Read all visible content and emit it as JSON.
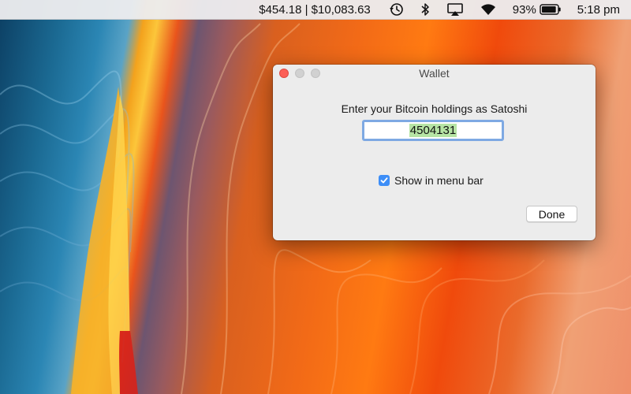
{
  "menubar": {
    "price_display": "$454.18 | $10,083.63",
    "time_machine_icon": "clock-history-icon",
    "bluetooth_icon": "bluetooth-icon",
    "airplay_icon": "airplay-icon",
    "wifi_icon": "wifi-icon",
    "battery_percent": "93%",
    "battery_level": 0.93,
    "battery_icon": "battery-icon",
    "time": "5:18 pm"
  },
  "window": {
    "title": "Wallet",
    "prompt": "Enter your Bitcoin holdings as Satoshi",
    "satoshi_value": "4504131",
    "show_in_menu_bar_label": "Show in menu bar",
    "show_in_menu_bar_checked": true,
    "done_label": "Done"
  },
  "colors": {
    "close_button": "#fc5f57",
    "checkbox_accent": "#3d8ef7",
    "focus_ring": "#7ea9e3",
    "text_highlight": "#b6e4a4"
  }
}
